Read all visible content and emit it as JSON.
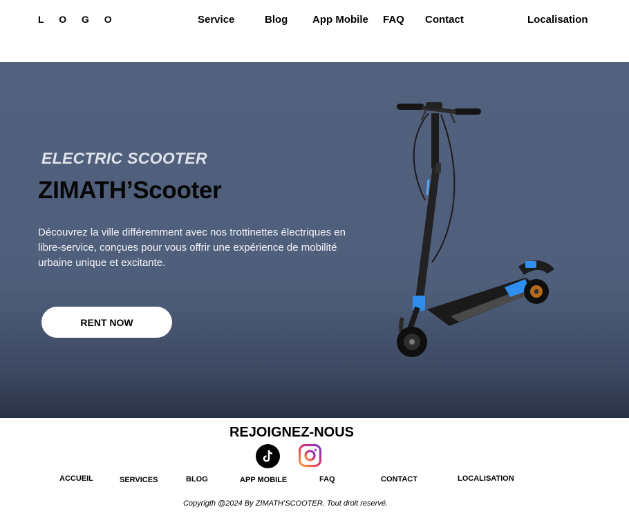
{
  "header": {
    "logo": "L O G O",
    "nav": [
      "Service",
      "Blog",
      "App Mobile",
      "FAQ",
      "Contact",
      "Localisation"
    ]
  },
  "hero": {
    "subtitle": "ELECTRIC SCOOTER",
    "title": "ZIMATH’Scooter",
    "description": "Découvrez la ville différemment avec nos trottinettes électriques en libre-service, conçues pour vous offrir une expérience de mobilité  urbaine unique et excitante.",
    "cta_label": "RENT NOW",
    "image": "electric-scooter-photo"
  },
  "footer": {
    "title": "REJOIGNEZ-NOUS",
    "social_icons": [
      "tiktok-icon",
      "instagram-icon"
    ],
    "links": [
      "ACCUEIL",
      "SERVICES",
      "BLOG",
      "APP MOBILE",
      "FAQ",
      "CONTACT",
      "LOCALISATION"
    ],
    "copyright": "Copyrigth @2024 By ZIMATH’SCOOTER. Tout droit reservé."
  },
  "colors": {
    "hero_bg": "#52627e",
    "hero_bg_bottom": "#2a3245",
    "accent_blue": "#2f8ff0"
  }
}
